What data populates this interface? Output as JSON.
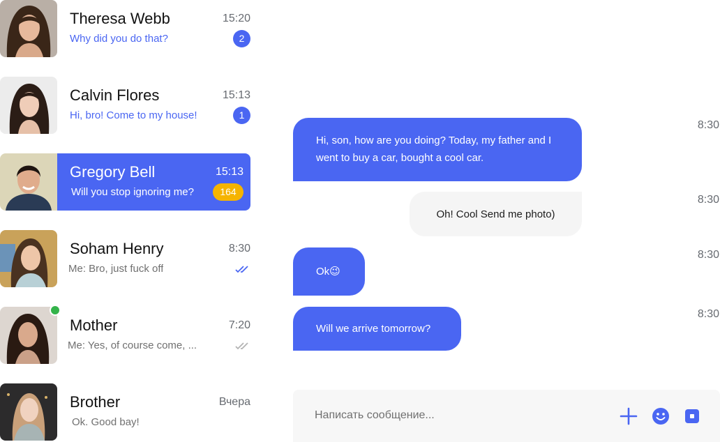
{
  "colors": {
    "accent": "#4a66f2",
    "badge_highlight": "#f5b400",
    "online": "#34b34a",
    "incoming_bubble": "#f5f5f5"
  },
  "chats": [
    {
      "name": "Theresa Webb",
      "time": "15:20",
      "preview": "Why did you do that?",
      "unread": "2",
      "state": "unread"
    },
    {
      "name": "Calvin Flores",
      "time": "15:13",
      "preview": "Hi, bro! Come to my house!",
      "unread": "1",
      "state": "unread"
    },
    {
      "name": "Gregory Bell",
      "time": "15:13",
      "preview": "Will you stop ignoring me?",
      "unread": "164",
      "state": "active"
    },
    {
      "name": "Soham Henry",
      "time": "8:30",
      "preview": "Me: Bro, just fuck off",
      "status_icon": "double-check-read-icon"
    },
    {
      "name": "Mother",
      "time": "7:20",
      "preview": "Me: Yes, of course come, ...",
      "status_icon": "double-check-sent-icon",
      "online": true
    },
    {
      "name": "Brother",
      "time": "Вчера",
      "preview": "Ok. Good bay!"
    }
  ],
  "messages": [
    {
      "text": "Hi, son, how are you doing? Today, my father and I went to buy a car, bought a cool car.",
      "time": "8:30",
      "direction": "out"
    },
    {
      "text": "Oh! Cool Send me photo)",
      "time": "8:30",
      "direction": "in"
    },
    {
      "text": "Ok😉",
      "time": "8:30",
      "direction": "out"
    },
    {
      "text": "Will we arrive tomorrow?",
      "time": "8:30",
      "direction": "out"
    }
  ],
  "composer": {
    "placeholder": "Написать сообщение...",
    "icons": [
      "plus-icon",
      "emoji-icon",
      "camera-icon"
    ]
  }
}
